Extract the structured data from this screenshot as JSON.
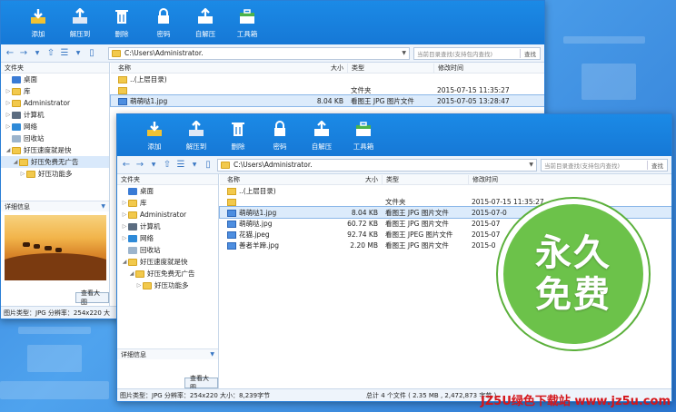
{
  "toolbar": {
    "buttons": [
      {
        "label": "添加",
        "icon": "add-icon"
      },
      {
        "label": "解压到",
        "icon": "extract-icon"
      },
      {
        "label": "删除",
        "icon": "delete-icon"
      },
      {
        "label": "密码",
        "icon": "lock-icon"
      },
      {
        "label": "自解压",
        "icon": "self-extract-icon"
      },
      {
        "label": "工具箱",
        "icon": "toolbox-icon"
      }
    ]
  },
  "address": {
    "path": "C:\\Users\\Administrator.",
    "search_placeholder": "当前目录查找(支持包内查找)",
    "search_button": "查找"
  },
  "left_panel": {
    "header": "文件夹",
    "tree": [
      {
        "label": "桌面"
      },
      {
        "label": "库"
      },
      {
        "label": "Administrator"
      },
      {
        "label": "计算机"
      },
      {
        "label": "网络"
      },
      {
        "label": "回收站"
      },
      {
        "label": "好压速度就是快"
      },
      {
        "label": "好压免费无广告"
      },
      {
        "label": "好压功能多"
      }
    ],
    "detail_header": "详细信息",
    "view_button": "查看大图"
  },
  "columns": {
    "name": "名称",
    "size": "大小",
    "type": "类型",
    "time": "修改时间"
  },
  "window1": {
    "rows": [
      {
        "name": "..(上层目录)",
        "size": "",
        "type": "",
        "time": ""
      },
      {
        "name": "",
        "size": "",
        "type": "文件夹",
        "time": "2015-07-15 11:35:27"
      },
      {
        "name": "萌萌哒1.jpg",
        "size": "8.04 KB",
        "type": "看图王 JPG 图片文件",
        "time": "2015-07-05 13:28:47"
      }
    ],
    "status": "图片类型：JPG 分辨率：254x220 大"
  },
  "window2": {
    "rows": [
      {
        "name": "..(上层目录)",
        "size": "",
        "type": "",
        "time": ""
      },
      {
        "name": "",
        "size": "",
        "type": "文件夹",
        "time": "2015-07-15 11:35:27"
      },
      {
        "name": "萌萌哒1.jpg",
        "size": "8.04 KB",
        "type": "看图王 JPG 图片文件",
        "time": "2015-07-0"
      },
      {
        "name": "萌萌哒.jpg",
        "size": "60.72 KB",
        "type": "看图王 JPG 图片文件",
        "time": "2015-07"
      },
      {
        "name": "花猫.jpeg",
        "size": "92.74 KB",
        "type": "看图王 JPEG 图片文件",
        "time": "2015-07"
      },
      {
        "name": "善者羊蹄.jpg",
        "size": "2.20 MB",
        "type": "看图王 JPG 图片文件",
        "time": "2015-0"
      }
    ],
    "status": "图片类型：JPG 分辨率：254x220 大小：8,239字节",
    "total": "总计 4 个文件 ( 2.35 MB , 2,472,873 字节 )"
  },
  "badge": {
    "line1": "永久",
    "line2": "免费"
  },
  "watermark": "JZ5U绿色下载站 www.jz5u.com"
}
